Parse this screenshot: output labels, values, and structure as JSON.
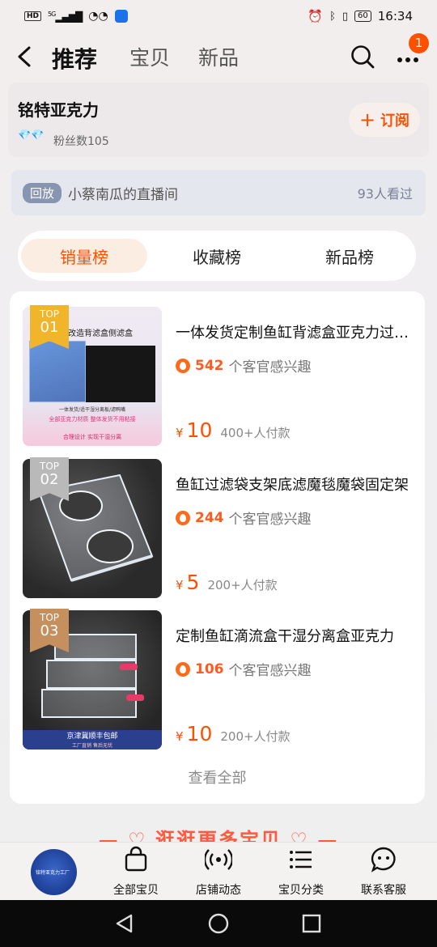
{
  "status_bar": {
    "hd": "HD",
    "signal": "5G",
    "time": "16:34",
    "battery": "60"
  },
  "nav": {
    "tabs": [
      "推荐",
      "宝贝",
      "新品"
    ],
    "active_tab": 0,
    "notification_count": "1"
  },
  "shop": {
    "name": "铭特亚克力",
    "fans": "粉丝数105",
    "subscribe_label": "订阅",
    "subscribe_icon": "plus-icon"
  },
  "replay": {
    "tag": "回放",
    "title": "小蔡南瓜的直播间",
    "viewers": "93人看过"
  },
  "rank_tabs": [
    "销量榜",
    "收藏榜",
    "新品榜"
  ],
  "products": [
    {
      "top_label": "TOP",
      "rank": "01",
      "badge_color": "#f1b52c",
      "title": "一体发货定制鱼缸背滤盒亚克力过滤盒侧滤盒",
      "interest_num": "542",
      "interest_text": "个客官感兴趣",
      "yen": "¥",
      "price": "10",
      "paid": "400+人付款",
      "thumb_header": "改造背滤盒侧滤盒",
      "thumb_line1": "一体发货/适干湿分离板/滤鸭嘴",
      "thumb_line2": "全部亚克力材质  整体发货不用粘接",
      "thumb_line3": "合理设计  实现干湿分离"
    },
    {
      "top_label": "TOP",
      "rank": "02",
      "badge_color": "#b9b9b9",
      "title": "鱼缸过滤袋支架底滤魔毯魔袋固定架",
      "interest_num": "244",
      "interest_text": "个客官感兴趣",
      "yen": "¥",
      "price": "5",
      "paid": "200+人付款"
    },
    {
      "top_label": "TOP",
      "rank": "03",
      "badge_color": "#c58f5e",
      "title": "定制鱼缸滴流盒干湿分离盒亚克力",
      "interest_num": "106",
      "interest_text": "个客官感兴趣",
      "yen": "¥",
      "price": "10",
      "paid": "200+人付款",
      "thumb_banner": "京津冀顺丰包邮",
      "thumb_sub": "工厂直销 售后无忧"
    }
  ],
  "view_all": "查看全部",
  "more_banner": "逛逛更多宝贝",
  "bottom_bar": {
    "avatar_text": "铭特亚克力工厂",
    "items": [
      {
        "label": "全部宝贝",
        "icon": "shopping-bag-icon"
      },
      {
        "label": "店铺动态",
        "icon": "broadcast-icon"
      },
      {
        "label": "宝贝分类",
        "icon": "list-icon"
      },
      {
        "label": "联系客服",
        "icon": "chat-face-icon"
      }
    ]
  },
  "accent_color": "#ff5000"
}
